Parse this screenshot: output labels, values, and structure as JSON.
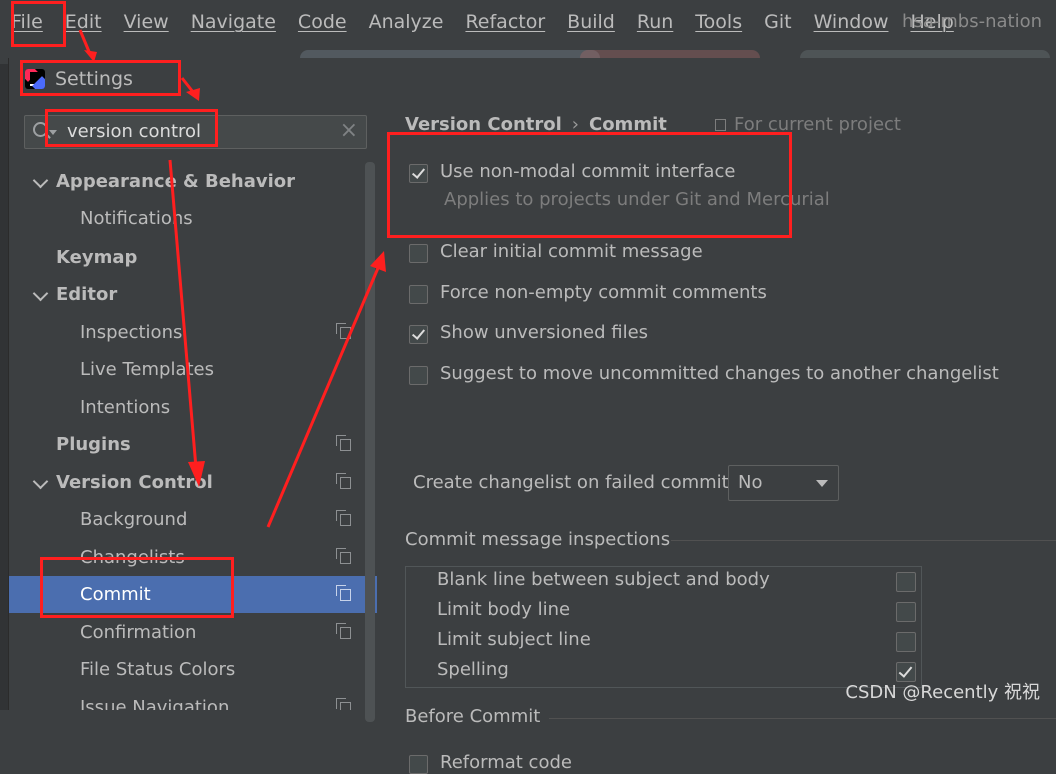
{
  "menu": {
    "items": [
      "File",
      "Edit",
      "View",
      "Navigate",
      "Code",
      "Analyze",
      "Refactor",
      "Build",
      "Run",
      "Tools",
      "Git",
      "Window",
      "Help"
    ],
    "project_name": "hsa-mbs-nation"
  },
  "dialog": {
    "title": "Settings"
  },
  "search": {
    "value": "version control",
    "clear_icon": "×"
  },
  "tree": {
    "items": [
      {
        "label": "Appearance & Behavior",
        "bold": true,
        "expanded": true
      },
      {
        "label": "Notifications"
      },
      {
        "label": "Keymap",
        "bold": true
      },
      {
        "label": "Editor",
        "bold": true,
        "expanded": true
      },
      {
        "label": "Inspections"
      },
      {
        "label": "Live Templates"
      },
      {
        "label": "Intentions"
      },
      {
        "label": "Plugins",
        "bold": true
      },
      {
        "label": "Version Control",
        "bold": true,
        "expanded": true
      },
      {
        "label": "Background"
      },
      {
        "label": "Changelists"
      },
      {
        "label": "Commit",
        "selected": true
      },
      {
        "label": "Confirmation"
      },
      {
        "label": "File Status Colors"
      },
      {
        "label": "Issue Navigation"
      }
    ]
  },
  "content": {
    "breadcrumb": {
      "parent": "Version Control",
      "separator": "›",
      "current": "Commit"
    },
    "scope_note": "For current project",
    "options": [
      {
        "label": "Use non-modal commit interface",
        "checked": true,
        "sub": "Applies to projects under Git and Mercurial"
      },
      {
        "label": "Clear initial commit message",
        "checked": false
      },
      {
        "label": "Force non-empty commit comments",
        "checked": false
      },
      {
        "label": "Show unversioned files",
        "checked": true
      },
      {
        "label": "Suggest to move uncommitted changes to another changelist",
        "checked": false
      }
    ],
    "changelist": {
      "label": "Create changelist on failed commit:",
      "value": "No"
    },
    "inspections_title": "Commit message inspections",
    "inspections": [
      {
        "label": "Blank line between subject and body",
        "checked": false
      },
      {
        "label": "Limit body line",
        "checked": false
      },
      {
        "label": "Limit subject line",
        "checked": false
      },
      {
        "label": "Spelling",
        "checked": true
      }
    ],
    "before_commit_title": "Before Commit",
    "before_commit_first": "Reformat code"
  },
  "watermark": "CSDN @Recently 祝祝",
  "colors": {
    "annotation": "#ff1f1f",
    "selection": "#4b6eaf",
    "background": "#3c3f41"
  }
}
